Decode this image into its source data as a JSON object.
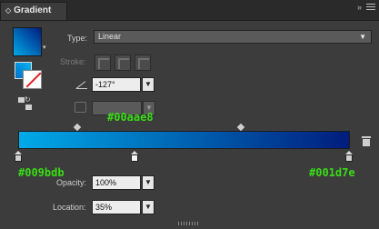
{
  "panel": {
    "tab_title": "Gradient",
    "close_glyph": "»"
  },
  "type": {
    "label": "Type:",
    "value": "Linear"
  },
  "stroke": {
    "label": "Stroke:"
  },
  "angle": {
    "value": "-127°"
  },
  "location": {
    "label": "Location:",
    "value": "35%"
  },
  "opacity": {
    "label": "Opacity:",
    "value": "100%"
  },
  "gradient": {
    "start_color": "#00aae8",
    "end_color": "#001d7e"
  },
  "annotations": {
    "midpoint_color": "#00aae8",
    "left_stop_color": "#009bdb",
    "right_stop_color": "#001d7e"
  },
  "icons": {
    "dropdown": "▼",
    "small_caret": "▾"
  }
}
